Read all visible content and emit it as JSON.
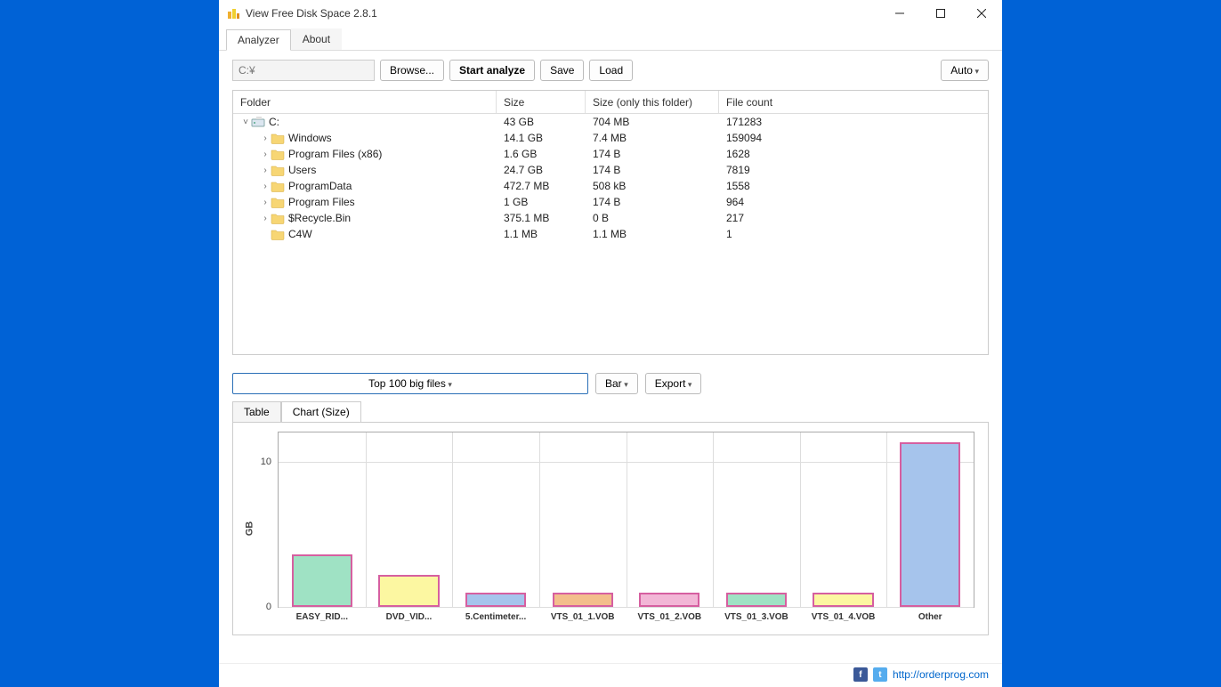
{
  "window": {
    "title": "View Free Disk Space 2.8.1"
  },
  "tabs": {
    "analyzer": "Analyzer",
    "about": "About"
  },
  "toolbar": {
    "path_value": "C:¥",
    "browse": "Browse...",
    "start": "Start analyze",
    "save": "Save",
    "load": "Load",
    "auto": "Auto"
  },
  "grid": {
    "headers": {
      "folder": "Folder",
      "size": "Size",
      "thissize": "Size (only this folder)",
      "count": "File count"
    },
    "rows": [
      {
        "indent": 0,
        "expander": "˅",
        "icon": "drive",
        "name": "C:",
        "size": "43 GB",
        "thissize": "704 MB",
        "count": "171283"
      },
      {
        "indent": 1,
        "expander": "›",
        "icon": "folder",
        "name": "Windows",
        "size": "14.1 GB",
        "thissize": "7.4 MB",
        "count": "159094"
      },
      {
        "indent": 1,
        "expander": "›",
        "icon": "folder",
        "name": "Program Files (x86)",
        "size": "1.6 GB",
        "thissize": "174 B",
        "count": "1628"
      },
      {
        "indent": 1,
        "expander": "›",
        "icon": "folder",
        "name": "Users",
        "size": "24.7 GB",
        "thissize": "174 B",
        "count": "7819"
      },
      {
        "indent": 1,
        "expander": "›",
        "icon": "folder",
        "name": "ProgramData",
        "size": "472.7 MB",
        "thissize": "508 kB",
        "count": "1558"
      },
      {
        "indent": 1,
        "expander": "›",
        "icon": "folder",
        "name": "Program Files",
        "size": "1 GB",
        "thissize": "174 B",
        "count": "964"
      },
      {
        "indent": 1,
        "expander": "›",
        "icon": "folder",
        "name": "$Recycle.Bin",
        "size": "375.1 MB",
        "thissize": "0 B",
        "count": "217"
      },
      {
        "indent": 1,
        "expander": "",
        "icon": "folder",
        "name": "C4W",
        "size": "1.1 MB",
        "thissize": "1.1 MB",
        "count": "1"
      }
    ]
  },
  "mid": {
    "topfiles": "Top 100 big files",
    "bar": "Bar",
    "export": "Export"
  },
  "lower_tabs": {
    "table": "Table",
    "chart": "Chart (Size)"
  },
  "footer": {
    "link": "http://orderprog.com"
  },
  "chart_data": {
    "type": "bar",
    "ylabel": "GB",
    "yticks": [
      0,
      10
    ],
    "ylim": [
      0,
      12
    ],
    "categories": [
      "EASY_RID...",
      "DVD_VID...",
      "5.Centimeter...",
      "VTS_01_1.VOB",
      "VTS_01_2.VOB",
      "VTS_01_3.VOB",
      "VTS_01_4.VOB",
      "Other"
    ],
    "values": [
      3.6,
      2.2,
      1.0,
      1.0,
      1.0,
      1.0,
      1.0,
      11.3
    ],
    "colors": [
      {
        "fill": "#9fe2c4",
        "stroke": "#d65fa0"
      },
      {
        "fill": "#fcf7a1",
        "stroke": "#d65fa0"
      },
      {
        "fill": "#a6c4ec",
        "stroke": "#d65fa0"
      },
      {
        "fill": "#f3be8c",
        "stroke": "#d65fa0"
      },
      {
        "fill": "#f2b6d6",
        "stroke": "#d65fa0"
      },
      {
        "fill": "#9fe2c4",
        "stroke": "#d65fa0"
      },
      {
        "fill": "#fcf7a1",
        "stroke": "#d65fa0"
      },
      {
        "fill": "#a6c4ec",
        "stroke": "#d65fa0"
      }
    ]
  }
}
